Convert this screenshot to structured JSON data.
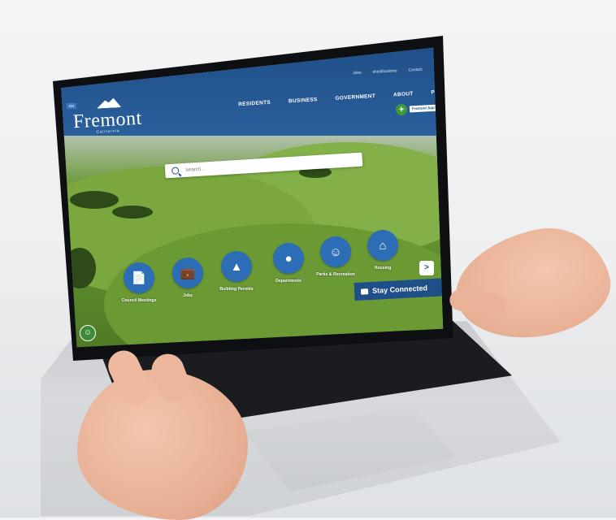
{
  "site": {
    "utility_links": [
      "Jobs",
      "eNotifications",
      "Contact"
    ],
    "nav": [
      "RESIDENTS",
      "BUSINESS",
      "GOVERNMENT",
      "ABOUT",
      "PERMITS"
    ],
    "lang_label": "EN",
    "logo": {
      "city_name": "Fremont",
      "sub": "California"
    },
    "app_button_label": "Fremont App",
    "search_placeholder": "Search...",
    "quick_links": [
      {
        "label": "Council Meetings",
        "icon": "document-icon"
      },
      {
        "label": "Jobs",
        "icon": "briefcase-icon"
      },
      {
        "label": "Building Permits",
        "icon": "stamp-icon"
      },
      {
        "label": "Departments",
        "icon": "org-chart-icon"
      },
      {
        "label": "Parks & Recreation",
        "icon": "family-icon"
      },
      {
        "label": "Housing",
        "icon": "house-icon"
      }
    ],
    "next_arrow": ">",
    "stay_connected": "Stay Connected"
  },
  "colors": {
    "header_blue": "#1f4f88",
    "button_blue": "#2c6db5",
    "green_accent": "#3f9a3c"
  }
}
